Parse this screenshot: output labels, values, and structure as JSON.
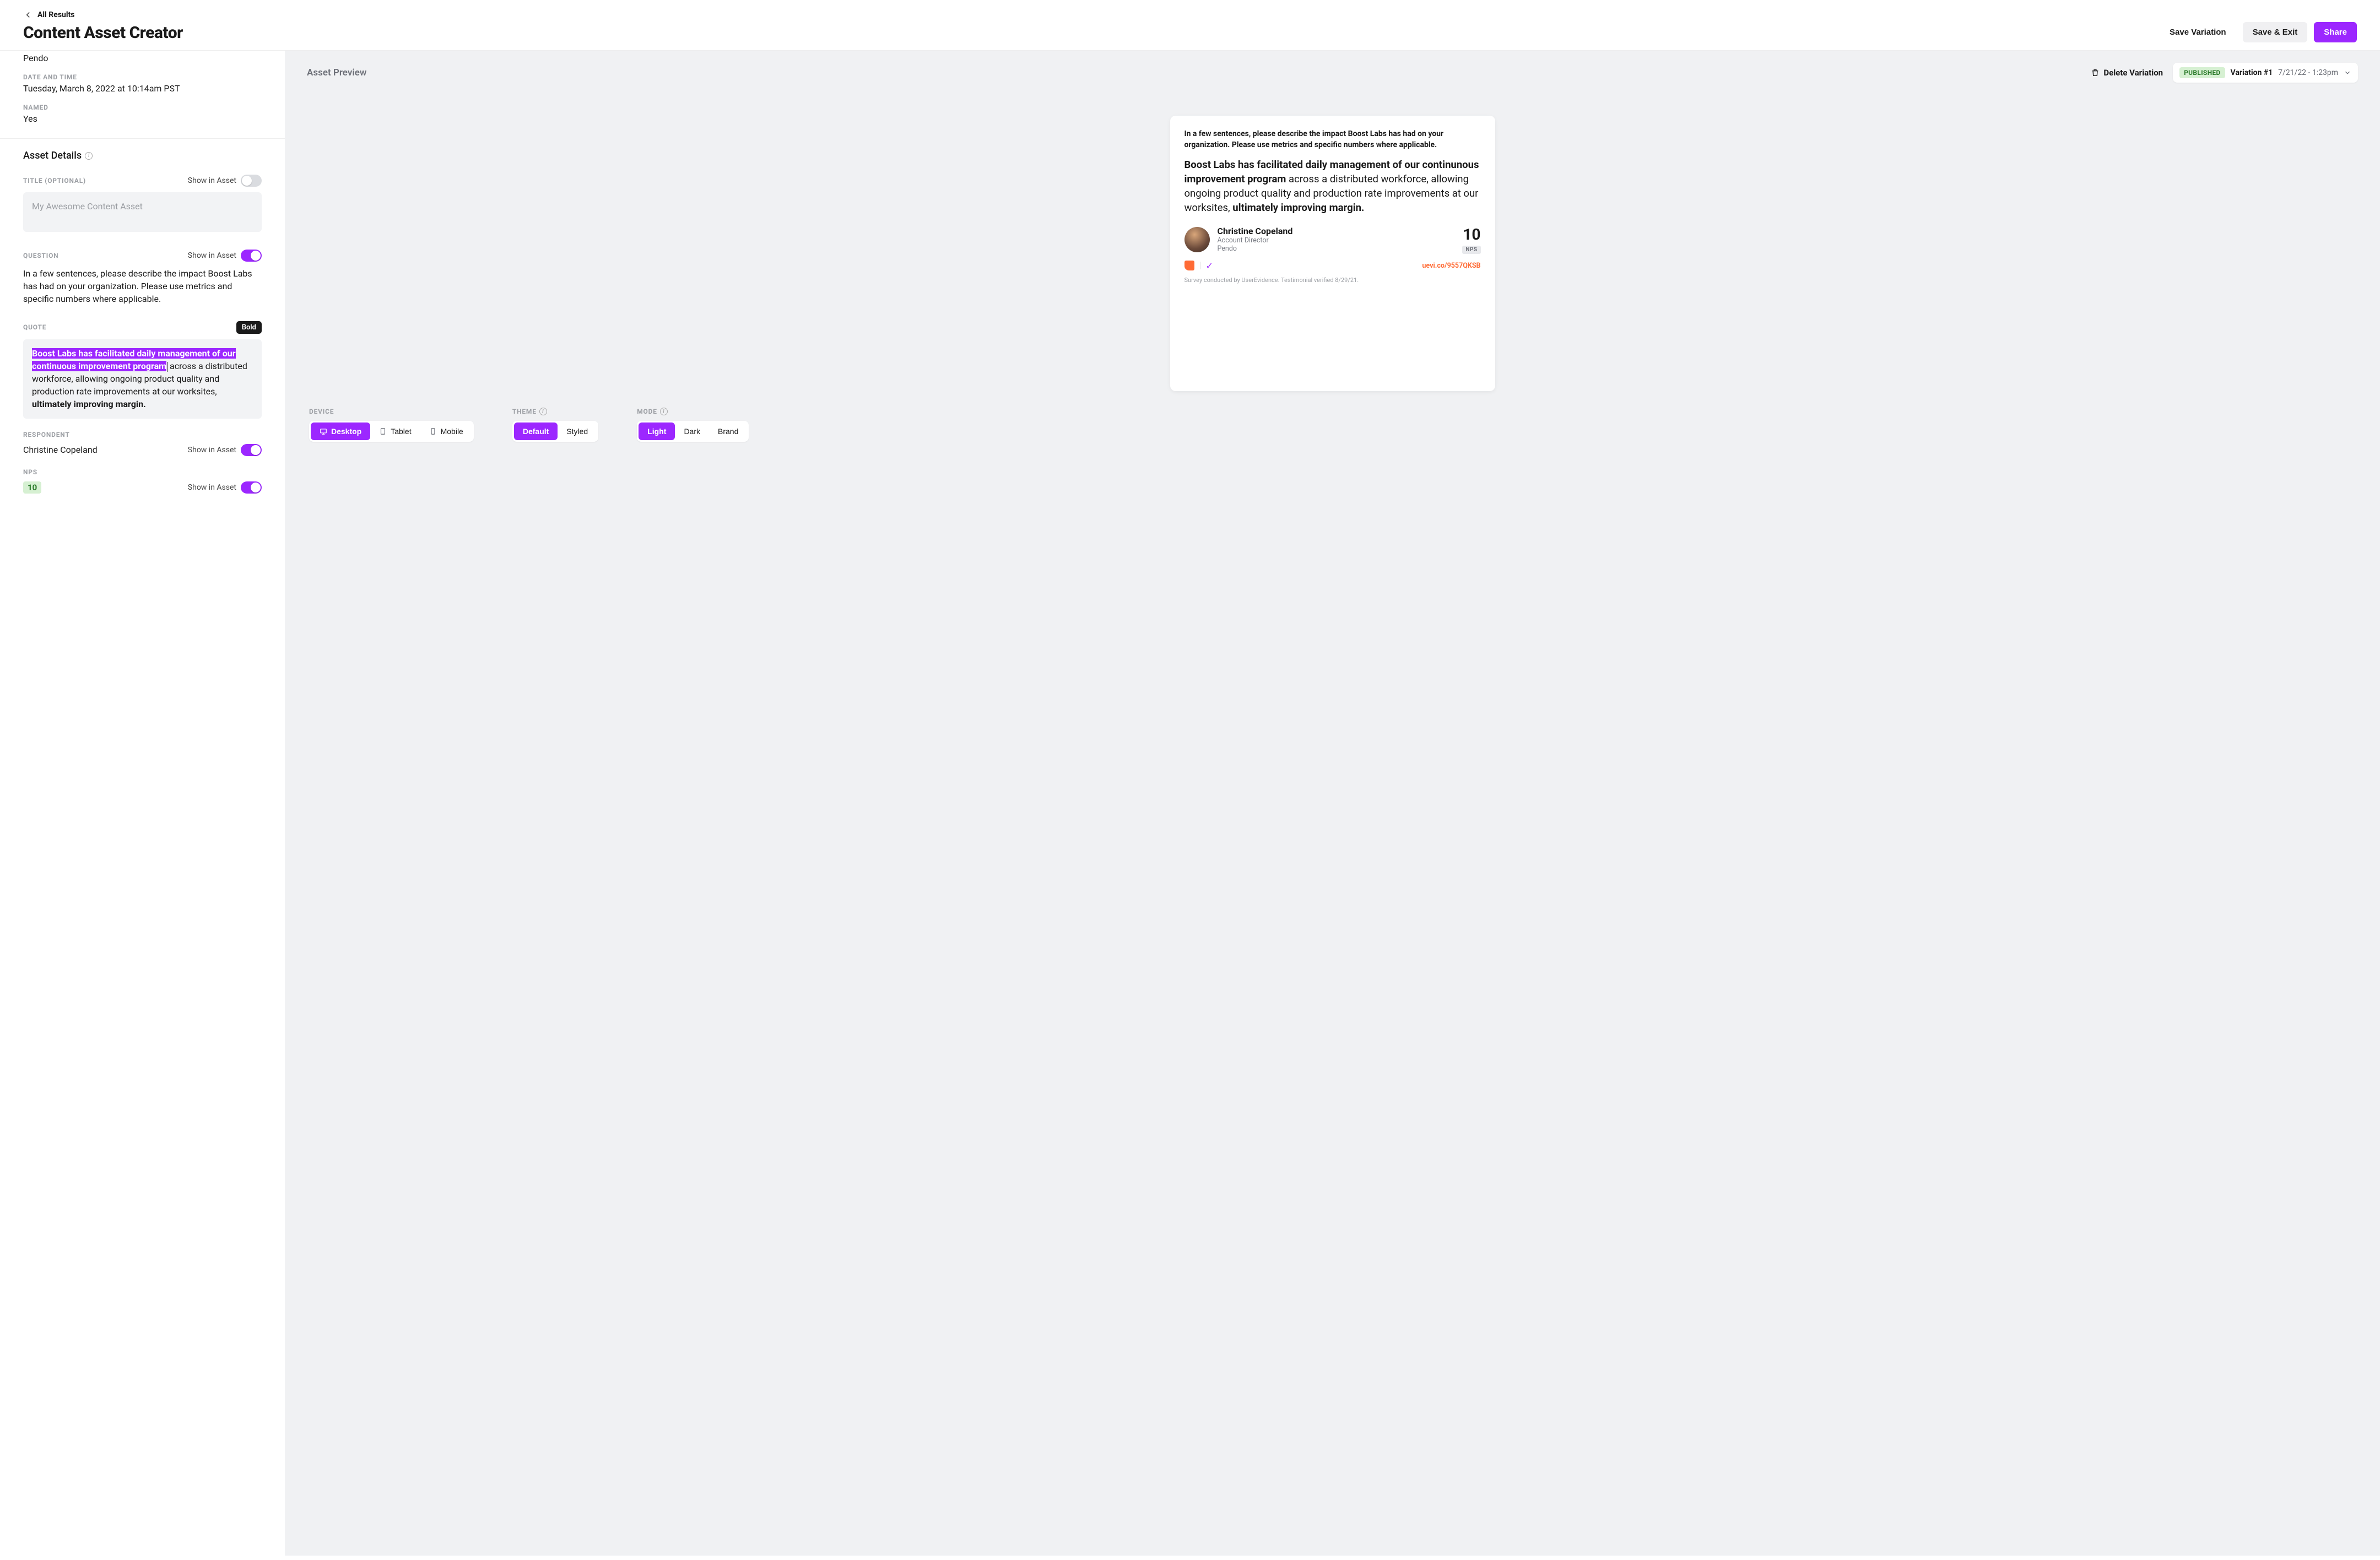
{
  "header": {
    "back_label": "All Results",
    "title": "Content Asset Creator",
    "save_variation": "Save Variation",
    "save_exit": "Save & Exit",
    "share": "Share"
  },
  "meta": {
    "company_value": "Pendo",
    "datetime_label": "DATE AND TIME",
    "datetime_value": "Tuesday, March 8, 2022 at 10:14am PST",
    "named_label": "NAMED",
    "named_value": "Yes"
  },
  "details": {
    "section_title": "Asset Details",
    "title_label": "TITLE (OPTIONAL)",
    "show_in_asset": "Show in Asset",
    "title_placeholder": "My Awesome Content Asset",
    "question_label": "QUESTION",
    "question_text": "In a few sentences, please describe the impact Boost Labs has had on your organization. Please use metrics and specific numbers where applicable.",
    "quote_label": "QUOTE",
    "bold_tooltip": "Bold",
    "quote_selected": "Boost Labs has facilitated daily management of our continuous improvement program",
    "quote_middle": " across a distributed workforce, allowing ongoing product quality and production rate improvements at our worksites, ",
    "quote_bold_end": "ultimately improving margin.",
    "respondent_label": "RESPONDENT",
    "respondent_value": "Christine Copeland",
    "nps_label": "NPS",
    "nps_value": "10"
  },
  "preview": {
    "title": "Asset Preview",
    "delete_variation": "Delete Variation",
    "status": "PUBLISHED",
    "variation_name": "Variation #1",
    "variation_date": "7/21/22 - 1:23pm",
    "asset": {
      "question": "In a few sentences, please describe the impact Boost Labs has had on your organization. Please use metrics and specific numbers where applicable.",
      "quote_bold1": "Boost Labs has facilitated daily management of our continunous improvement program",
      "quote_mid": " across a distributed workforce, allowing ongoing product quality and production rate improvements at our worksites, ",
      "quote_bold2": "ultimately improving margin.",
      "person_name": "Christine Copeland",
      "person_role": "Account Director",
      "person_company": "Pendo",
      "nps_score": "10",
      "nps_tag": "NPS",
      "short_link": "uevi.co/9557QKSB",
      "disclaimer": "Survey conducted by UserEvidence. Testimonial verified 8/29/21."
    }
  },
  "controls": {
    "device_label": "DEVICE",
    "device_options": [
      "Desktop",
      "Tablet",
      "Mobile"
    ],
    "theme_label": "THEME",
    "theme_options": [
      "Default",
      "Styled"
    ],
    "mode_label": "MODE",
    "mode_options": [
      "Light",
      "Dark",
      "Brand"
    ]
  }
}
